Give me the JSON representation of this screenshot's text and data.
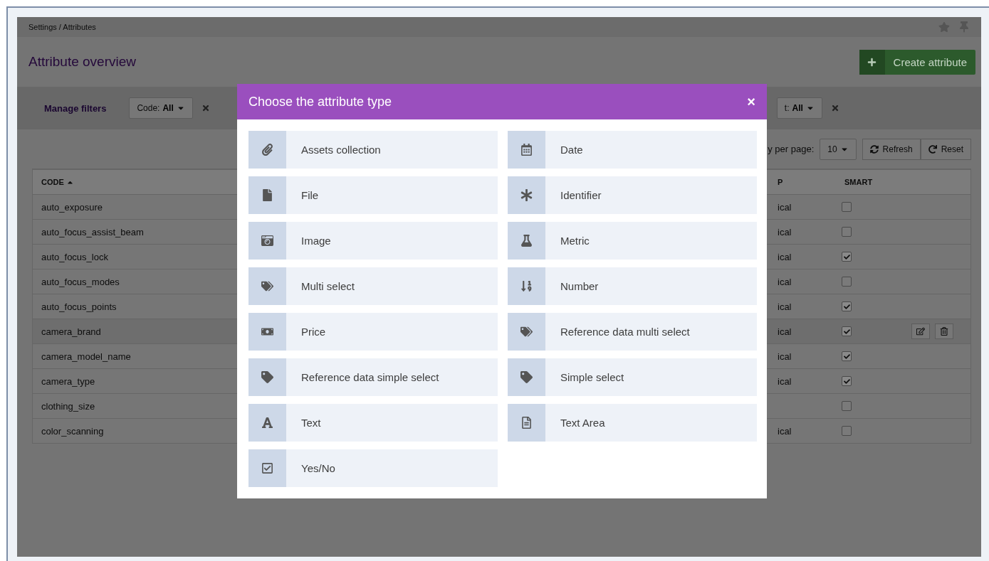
{
  "breadcrumb": "Settings / Attributes",
  "page_title": "Attribute overview",
  "create_button": "Create attribute",
  "filters": {
    "manage_label": "Manage filters",
    "items": [
      {
        "label": "Code:",
        "value": "All"
      },
      {
        "label": "t:",
        "value": "All"
      }
    ]
  },
  "toolbar": {
    "per_page_label": "y per page:",
    "per_page_value": "10",
    "buttons": [
      {
        "kind": "refresh",
        "label": "Refresh"
      },
      {
        "kind": "reset",
        "label": "Reset"
      }
    ]
  },
  "table": {
    "columns": [
      "CODE",
      "P",
      "SMART"
    ],
    "rows": [
      {
        "code": "auto_exposure",
        "column_2": "ical",
        "smart": false,
        "hovered": false
      },
      {
        "code": "auto_focus_assist_beam",
        "column_2": "ical",
        "smart": false,
        "hovered": false
      },
      {
        "code": "auto_focus_lock",
        "column_2": "ical",
        "smart": true,
        "hovered": false
      },
      {
        "code": "auto_focus_modes",
        "column_2": "ical",
        "smart": false,
        "hovered": false
      },
      {
        "code": "auto_focus_points",
        "column_2": "ical",
        "smart": true,
        "hovered": false
      },
      {
        "code": "camera_brand",
        "column_2": "ical",
        "smart": true,
        "hovered": true
      },
      {
        "code": "camera_model_name",
        "column_2": "ical",
        "smart": true,
        "hovered": false
      },
      {
        "code": "camera_type",
        "column_2": "ical",
        "smart": true,
        "hovered": false
      },
      {
        "code": "clothing_size",
        "smart": false,
        "hovered": false
      },
      {
        "code": "color_scanning",
        "column_2": "ical",
        "smart": false,
        "hovered": false
      }
    ]
  },
  "modal": {
    "title": "Choose the attribute type",
    "close": "×",
    "types": [
      {
        "kind": "assets",
        "label": "Assets collection"
      },
      {
        "kind": "date",
        "label": "Date"
      },
      {
        "kind": "file",
        "label": "File"
      },
      {
        "kind": "identifier",
        "label": "Identifier"
      },
      {
        "kind": "image",
        "label": "Image"
      },
      {
        "kind": "metric",
        "label": "Metric"
      },
      {
        "kind": "multiselect",
        "label": "Multi select"
      },
      {
        "kind": "number",
        "label": "Number"
      },
      {
        "kind": "price",
        "label": "Price"
      },
      {
        "kind": "refmulti",
        "label": "Reference data multi select"
      },
      {
        "kind": "refsimple",
        "label": "Reference data simple select"
      },
      {
        "kind": "simpleselect",
        "label": "Simple select"
      },
      {
        "kind": "text",
        "label": "Text"
      },
      {
        "kind": "textarea",
        "label": "Text Area"
      },
      {
        "kind": "boolean",
        "label": "Yes/No"
      }
    ]
  }
}
